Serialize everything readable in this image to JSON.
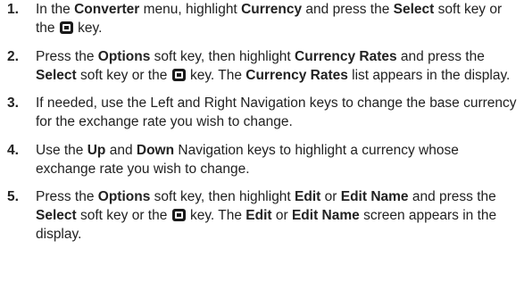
{
  "steps": [
    {
      "number": "1.",
      "t1": "In the ",
      "b1": "Converter",
      "t2": " menu, highlight ",
      "b2": "Currency",
      "t3": " and press the ",
      "b3": "Select",
      "t4": " soft key or the ",
      "t5": " key."
    },
    {
      "number": "2.",
      "t1": "Press the ",
      "b1": "Options",
      "t2": " soft key, then highlight ",
      "b2": "Currency Rates",
      "t3": " and press the ",
      "b3": "Select",
      "t4": " soft key or the ",
      "t5": " key. The ",
      "b4": "Currency Rates",
      "t6": " list appears in the display."
    },
    {
      "number": "3.",
      "text": "If needed, use the Left and Right Navigation keys to change the base currency for the exchange rate you wish to change."
    },
    {
      "number": "4.",
      "t1": "Use the ",
      "b1": "Up",
      "t2": " and ",
      "b2": "Down",
      "t3": " Navigation keys to highlight a currency whose exchange rate you wish to change."
    },
    {
      "number": "5.",
      "t1": "Press the ",
      "b1": "Options",
      "t2": " soft key, then highlight ",
      "b2": "Edit",
      "t3": " or ",
      "b3": "Edit Name",
      "t4": " and press the ",
      "b4": "Select",
      "t5": " soft key or the ",
      "t6": " key. The ",
      "b5": "Edit",
      "t7": " or ",
      "b6": "Edit Name",
      "t8": " screen appears in the display."
    }
  ],
  "icons": {
    "select_key": "select-key-icon"
  }
}
